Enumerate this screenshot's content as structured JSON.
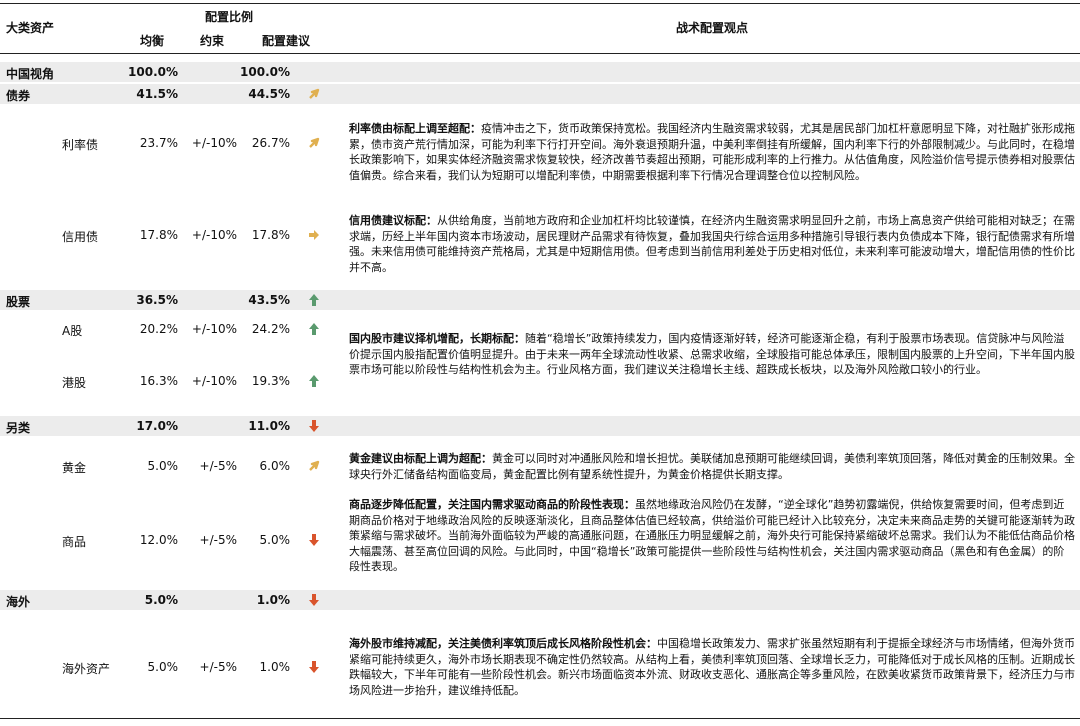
{
  "header": {
    "asset_class": "大类资产",
    "allocation": "配置比例",
    "balanced": "均衡",
    "constraint": "约束",
    "suggestion": "配置建议",
    "view": "战术配置观点"
  },
  "colors": {
    "up_strong": "#5a9a6e",
    "up_soft": "#e0b050",
    "right": "#e0b050",
    "down": "#d9542c",
    "band": "#ececec"
  },
  "rows": {
    "china": {
      "label": "中国视角",
      "balanced": "100.0%",
      "suggestion": "100.0%"
    },
    "bond": {
      "label": "债券",
      "balanced": "41.5%",
      "suggestion": "44.5%",
      "arrow": "up-right-arrow"
    },
    "rate_bond": {
      "label": "利率债",
      "balanced": "23.7%",
      "constraint": "+/-10%",
      "suggestion": "26.7%",
      "arrow": "up-right-arrow"
    },
    "credit_bond": {
      "label": "信用债",
      "balanced": "17.8%",
      "constraint": "+/-10%",
      "suggestion": "17.8%",
      "arrow": "right-arrow"
    },
    "equity": {
      "label": "股票",
      "balanced": "36.5%",
      "suggestion": "43.5%",
      "arrow": "up-arrow"
    },
    "a_share": {
      "label": "A股",
      "balanced": "20.2%",
      "constraint": "+/-10%",
      "suggestion": "24.2%",
      "arrow": "up-arrow"
    },
    "hk_share": {
      "label": "港股",
      "balanced": "16.3%",
      "constraint": "+/-10%",
      "suggestion": "19.3%",
      "arrow": "up-arrow"
    },
    "alt": {
      "label": "另类",
      "balanced": "17.0%",
      "suggestion": "11.0%",
      "arrow": "down-arrow"
    },
    "gold": {
      "label": "黄金",
      "balanced": "5.0%",
      "constraint": "+/-5%",
      "suggestion": "6.0%",
      "arrow": "up-right-arrow"
    },
    "commodity": {
      "label": "商品",
      "balanced": "12.0%",
      "constraint": "+/-5%",
      "suggestion": "5.0%",
      "arrow": "down-arrow"
    },
    "overseas": {
      "label": "海外",
      "balanced": "5.0%",
      "suggestion": "1.0%",
      "arrow": "down-arrow"
    },
    "overseas_asset": {
      "label": "海外资产",
      "balanced": "5.0%",
      "constraint": "+/-5%",
      "suggestion": "1.0%",
      "arrow": "down-arrow"
    }
  },
  "views": {
    "rate_bond": {
      "title": "利率债由标配上调至超配：",
      "body": "疫情冲击之下，货币政策保持宽松。我国经济内生融资需求较弱，尤其是居民部门加杠杆意愿明显下降，对社融扩张形成拖累，债市资产荒行情加深，可能为利率下行打开空间。海外衰退预期升温，中美利率倒挂有所缓解，国内利率下行的外部限制减少。与此同时，在稳增长政策影响下，如果实体经济融资需求恢复较快，经济改善节奏超出预期，可能形成利率的上行推力。从估值角度，风险溢价信号提示债券相对股票估值偏贵。综合来看，我们认为短期可以增配利率债，中期需要根据利率下行情况合理调整仓位以控制风险。"
    },
    "credit_bond": {
      "title": "信用债建议标配：",
      "body": "从供给角度，当前地方政府和企业加杠杆均比较谨慎，在经济内生融资需求明显回升之前，市场上高息资产供给可能相对缺乏；在需求端，历经上半年国内资本市场波动，居民理财产品需求有待恢复，叠加我国央行综合运用多种措施引导银行表内负债成本下降，银行配债需求有所增强。未来信用债可能维持资产荒格局，尤其是中短期信用债。但考虑到当前信用利差处于历史相对低位，未来利率可能波动增大，增配信用债的性价比并不高。"
    },
    "equity": {
      "title": "国内股市建议择机增配，长期标配：",
      "body": "随着“稳增长”政策持续发力，国内疫情逐渐好转，经济可能逐渐企稳，有利于股票市场表现。信贷脉冲与风险溢价提示国内股指配置价值明显提升。由于未来一两年全球流动性收紧、总需求收缩，全球股指可能总体承压，限制国内股票的上升空间，下半年国内股票市场可能以阶段性与结构性机会为主。行业风格方面，我们建议关注稳增长主线、超跌成长板块，以及海外风险敞口较小的行业。"
    },
    "gold": {
      "title": "黄金建议由标配上调为超配：",
      "body": "黄金可以同时对冲通胀风险和增长担忧。美联储加息预期可能继续回调，美债利率筑顶回落，降低对黄金的压制效果。全球央行外汇储备结构面临变局，黄金配置比例有望系统性提升，为黄金价格提供长期支撑。"
    },
    "commodity": {
      "title": "商品逐步降低配置，关注国内需求驱动商品的阶段性表现：",
      "body": "虽然地缘政治风险仍在发酵，“逆全球化”趋势初露端倪，供给恢复需要时间，但考虑到近期商品价格对于地缘政治风险的反映逐渐淡化，且商品整体估值已经较高，供给溢价可能已经计入比较充分，决定未来商品走势的关键可能逐渐转为政策紧缩与需求破坏。当前海外面临较为严峻的高通胀问题，在通胀压力明显缓解之前，海外央行可能保持紧缩破坏总需求。我们认为不能低估商品价格大幅震荡、甚至高位回调的风险。与此同时，中国“稳增长”政策可能提供一些阶段性与结构性机会，关注国内需求驱动商品（黑色和有色金属）的阶段性表现。"
    },
    "overseas": {
      "title": "海外股市维持减配，关注美债利率筑顶后成长风格阶段性机会：",
      "body": "中国稳增长政策发力、需求扩张虽然短期有利于提振全球经济与市场情绪，但海外货币紧缩可能持续更久，海外市场长期表现不确定性仍然较高。从结构上看，美债利率筑顶回落、全球增长乏力，可能降低对于成长风格的压制。近期成长跌幅较大，下半年可能有一些阶段性机会。新兴市场面临资本外流、财政收支恶化、通胀高企等多重风险，在欧美收紧货币政策背景下，经济压力与市场风险进一步抬升，建议维持低配。"
    }
  }
}
